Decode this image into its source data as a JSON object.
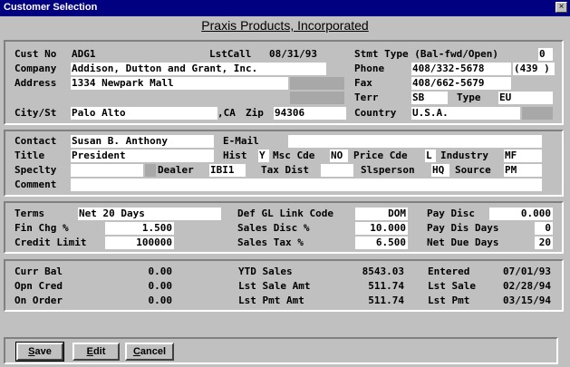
{
  "window": {
    "title": "Customer Selection",
    "close_glyph": "×"
  },
  "company_name": "Praxis Products, Incorporated",
  "customer": {
    "cust_no": {
      "label": "Cust No",
      "value": "ADG1"
    },
    "last_call": {
      "label": "LstCall",
      "value": "08/31/93"
    },
    "stmt_type": {
      "label": "Stmt Type (Bal-fwd/Open)",
      "value": "0"
    },
    "company": {
      "label": "Company",
      "value": "Addison, Dutton and Grant, Inc."
    },
    "phone": {
      "label": "Phone",
      "value": "408/332-5678",
      "ext": "(439 )"
    },
    "address": {
      "label": "Address",
      "value": "1334 Newpark Mall"
    },
    "fax": {
      "label": "Fax",
      "value": "408/662-5679"
    },
    "terr": {
      "label": "Terr",
      "value": "SB"
    },
    "type": {
      "label": "Type",
      "value": "EU"
    },
    "city_st": {
      "label": "City/St",
      "city": "Palo Alto",
      "state": ",CA"
    },
    "zip": {
      "label": "Zip",
      "value": "94306"
    },
    "country": {
      "label": "Country",
      "value": "U.S.A."
    }
  },
  "contact": {
    "contact": {
      "label": "Contact",
      "value": "Susan B. Anthony"
    },
    "email": {
      "label": "E-Mail",
      "value": ""
    },
    "title": {
      "label": "Title",
      "value": "President"
    },
    "hist": {
      "label": "Hist",
      "value": "Y"
    },
    "msc_cde": {
      "label": "Msc Cde",
      "value": "NO"
    },
    "price_cde": {
      "label": "Price Cde",
      "value": "L"
    },
    "industry": {
      "label": "Industry",
      "value": "MF"
    },
    "specialty": {
      "label": "Speclty",
      "value": ""
    },
    "dealer": {
      "label": "Dealer",
      "value": "IBI1"
    },
    "tax_dist": {
      "label": "Tax Dist",
      "value": ""
    },
    "slsperson": {
      "label": "Slsperson",
      "value": "HQ"
    },
    "source": {
      "label": "Source",
      "value": "PM"
    },
    "comment": {
      "label": "Comment",
      "value": ""
    }
  },
  "terms": {
    "terms": {
      "label": "Terms",
      "value": "Net 20 Days"
    },
    "def_gl": {
      "label": "Def GL Link Code",
      "value": "DOM"
    },
    "pay_disc": {
      "label": "Pay Disc",
      "value": "0.000"
    },
    "fin_chg": {
      "label": "Fin Chg %",
      "value": "1.500"
    },
    "sales_disc": {
      "label": "Sales Disc %",
      "value": "10.000"
    },
    "pay_dis_days": {
      "label": "Pay Dis Days",
      "value": "0"
    },
    "credit_limit": {
      "label": "Credit Limit",
      "value": "100000"
    },
    "sales_tax": {
      "label": "Sales Tax %",
      "value": "6.500"
    },
    "net_due_days": {
      "label": "Net Due Days",
      "value": "20"
    }
  },
  "balances": {
    "curr_bal": {
      "label": "Curr Bal",
      "value": "0.00"
    },
    "ytd_sales": {
      "label": "YTD Sales",
      "value": "8543.03"
    },
    "entered": {
      "label": "Entered",
      "value": "07/01/93"
    },
    "opn_cred": {
      "label": "Opn Cred",
      "value": "0.00"
    },
    "lst_sale_amt": {
      "label": "Lst Sale Amt",
      "value": "511.74"
    },
    "lst_sale": {
      "label": "Lst Sale",
      "value": "02/28/94"
    },
    "on_order": {
      "label": "On Order",
      "value": "0.00"
    },
    "lst_pmt_amt": {
      "label": "Lst Pmt Amt",
      "value": "511.74"
    },
    "lst_pmt": {
      "label": "Lst Pmt",
      "value": "03/15/94"
    }
  },
  "buttons": {
    "save": {
      "hotkey": "S",
      "rest": "ave"
    },
    "edit": {
      "hotkey": "E",
      "rest": "dit"
    },
    "cancel": {
      "hotkey": "C",
      "rest": "ancel"
    }
  }
}
